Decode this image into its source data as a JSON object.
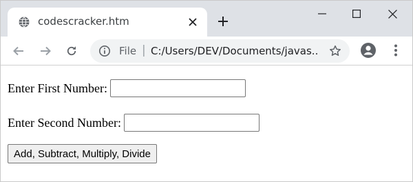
{
  "browser": {
    "tab": {
      "title": "codescracker.htm",
      "favicon": "globe-icon",
      "close_icon": "close-icon"
    },
    "new_tab_icon": "plus-icon",
    "window_controls": [
      "minimize-icon",
      "maximize-icon",
      "close-icon"
    ],
    "toolbar": {
      "back_icon": "arrow-left-icon",
      "forward_icon": "arrow-right-icon",
      "reload_icon": "reload-icon",
      "address": {
        "info_icon": "info-icon",
        "scheme_label": "File",
        "separator": "|",
        "url": "C:/Users/DEV/Documents/javas..."
      },
      "bookmark_icon": "star-icon",
      "profile_icon": "account-icon",
      "menu_icon": "more-vert-icon"
    }
  },
  "page": {
    "first_label": "Enter First Number:",
    "first_value": "",
    "second_label": "Enter Second Number:",
    "second_value": "",
    "button_label": "Add, Subtract, Multiply, Divide"
  },
  "colors": {
    "tabstrip": "#dee1e6",
    "omnibox": "#f1f3f4",
    "icon": "#5f6368",
    "button_bg": "#efefef"
  }
}
